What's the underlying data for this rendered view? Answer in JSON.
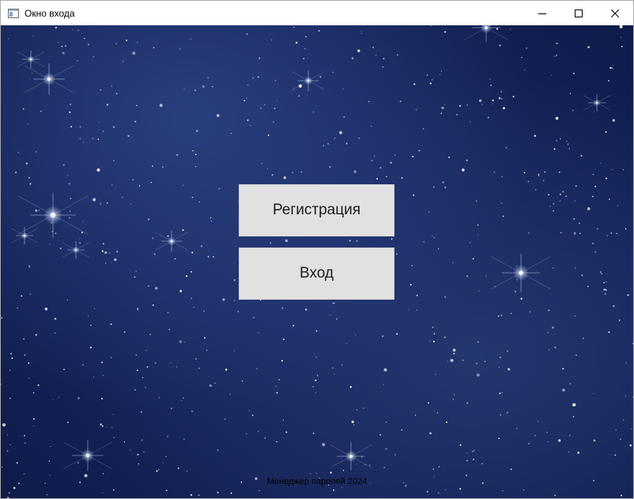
{
  "window": {
    "title": "Окно входа",
    "icon": "app-window-icon",
    "controls": {
      "minimize_icon": "minimize-icon",
      "maximize_icon": "maximize-icon",
      "close_icon": "close-icon"
    }
  },
  "main": {
    "background": "starry-night-sky",
    "register_label": "Регистрация",
    "login_label": "Вход",
    "footer_text": "Менеджер паролей 2024"
  },
  "colors": {
    "button_bg": "#e1e1e1",
    "sky_dark": "#0f1b4a",
    "sky_light": "#2a3f7e"
  }
}
